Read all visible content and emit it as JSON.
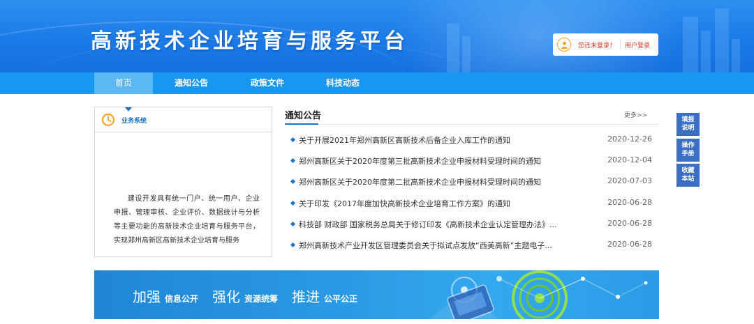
{
  "header": {
    "site_title": "高新技术企业培育与服务平台",
    "login_status": "您还未登录！",
    "login_button": "用户登录"
  },
  "nav": {
    "items": [
      {
        "label": "首页",
        "active": true
      },
      {
        "label": "通知公告"
      },
      {
        "label": "政策文件"
      },
      {
        "label": "科技动态"
      }
    ]
  },
  "business": {
    "title": "业务系统",
    "description": "建设开发具有统一门户、统一用户、企业申报、管理审核、企业评价、数据统计与分析等主要功能的高新技术企业培育与服务平台，实现郑州高新区高新技术企业培育与服务"
  },
  "notices": {
    "title": "通知公告",
    "more": "更多>>",
    "items": [
      {
        "title": "关于开展2021年郑州高新区高新技术后备企业入库工作的通知",
        "date": "2020-12-26"
      },
      {
        "title": "郑州高新区关于2020年度第三批高新技术企业申报材料受理时间的通知",
        "date": "2020-12-04"
      },
      {
        "title": "郑州高新区关于2020年度第二批高新技术企业申报材料受理时间的通知",
        "date": "2020-07-03"
      },
      {
        "title": "关于印发《2017年度加快高新技术企业培育工作方案》的通知",
        "date": "2020-06-28"
      },
      {
        "title": "科技部 财政部 国家税务总局关于修订印发《高新技术企业认定管理办法》...",
        "date": "2020-06-28"
      },
      {
        "title": "郑州高新技术产业开发区管理委员会关于拟试点发放“西美高新”主题电子...",
        "date": "2020-06-28"
      }
    ]
  },
  "side_buttons": [
    {
      "line1": "填报",
      "line2": "说明"
    },
    {
      "line1": "操作",
      "line2": "手册"
    },
    {
      "line1": "收藏",
      "line2": "本站"
    }
  ],
  "banner": {
    "items": [
      {
        "big": "加强",
        "small": "信息公开"
      },
      {
        "big": "强化",
        "small": "资源统筹"
      },
      {
        "big": "推进",
        "small": "公平公正"
      }
    ]
  },
  "colors": {
    "header_blue": "#1b7ae6",
    "nav_blue": "#1896f0",
    "nav_active": "#5cb7f5",
    "accent_blue": "#1a73c9",
    "alert_red": "#d83a2a",
    "side_button_blue": "#3a6fc2"
  },
  "icons": {
    "user": "user-icon",
    "clock": "clock-icon",
    "bullet": "diamond-bullet-icon"
  }
}
